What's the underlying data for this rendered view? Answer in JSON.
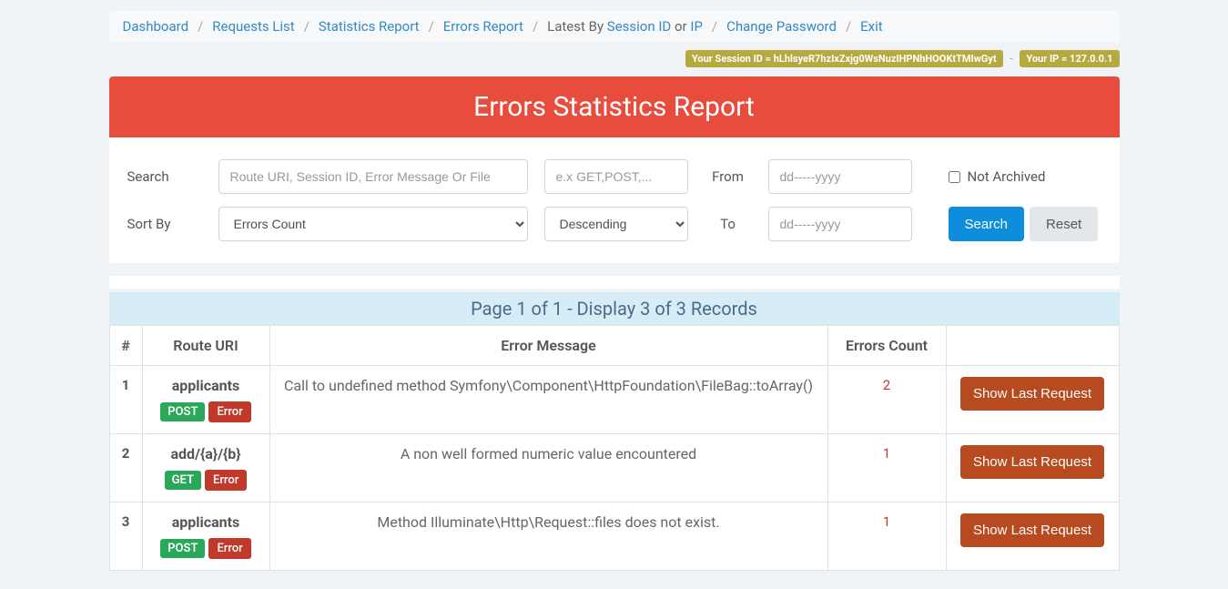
{
  "breadcrumb": {
    "dashboard": "Dashboard",
    "requests_list": "Requests List",
    "statistics_report": "Statistics Report",
    "errors_report": "Errors Report",
    "latest_by_prefix": "Latest By ",
    "session_id_link": "Session ID",
    "or_text": " or ",
    "ip_link": "IP",
    "change_password": "Change Password",
    "exit": "Exit"
  },
  "badges": {
    "session": "Your Session ID = hLhlsyeR7hzIxZxjg0WsNuzIHPNhHOOKtTMIwGyt",
    "ip": "Your IP = 127.0.0.1",
    "dash": "-"
  },
  "title": "Errors Statistics Report",
  "filters": {
    "search_label": "Search",
    "search_placeholder": "Route URI, Session ID, Error Message Or File",
    "method_placeholder": "e.x GET,POST,...",
    "from_label": "From",
    "to_label": "To",
    "date_placeholder": "dd-----yyyy",
    "not_archived_label": "Not Archived",
    "sort_by_label": "Sort By",
    "sort_field": "Errors Count",
    "sort_dir": "Descending",
    "search_btn": "Search",
    "reset_btn": "Reset"
  },
  "pagination_strip": "Page 1 of 1 - Display 3 of 3 Records",
  "table": {
    "headers": {
      "idx": "#",
      "uri": "Route URI",
      "msg": "Error Message",
      "count": "Errors Count",
      "act": ""
    },
    "error_badge": "Error",
    "last_request_btn": "Show Last Request",
    "rows": [
      {
        "idx": "1",
        "uri": "applicants",
        "method": "POST",
        "msg": "Call to undefined method Symfony\\Component\\HttpFoundation\\FileBag::toArray()",
        "count": "2"
      },
      {
        "idx": "2",
        "uri": "add/{a}/{b}",
        "method": "GET",
        "msg": "A non well formed numeric value encountered",
        "count": "1"
      },
      {
        "idx": "3",
        "uri": "applicants",
        "method": "POST",
        "msg": "Method Illuminate\\Http\\Request::files does not exist.",
        "count": "1"
      }
    ]
  }
}
